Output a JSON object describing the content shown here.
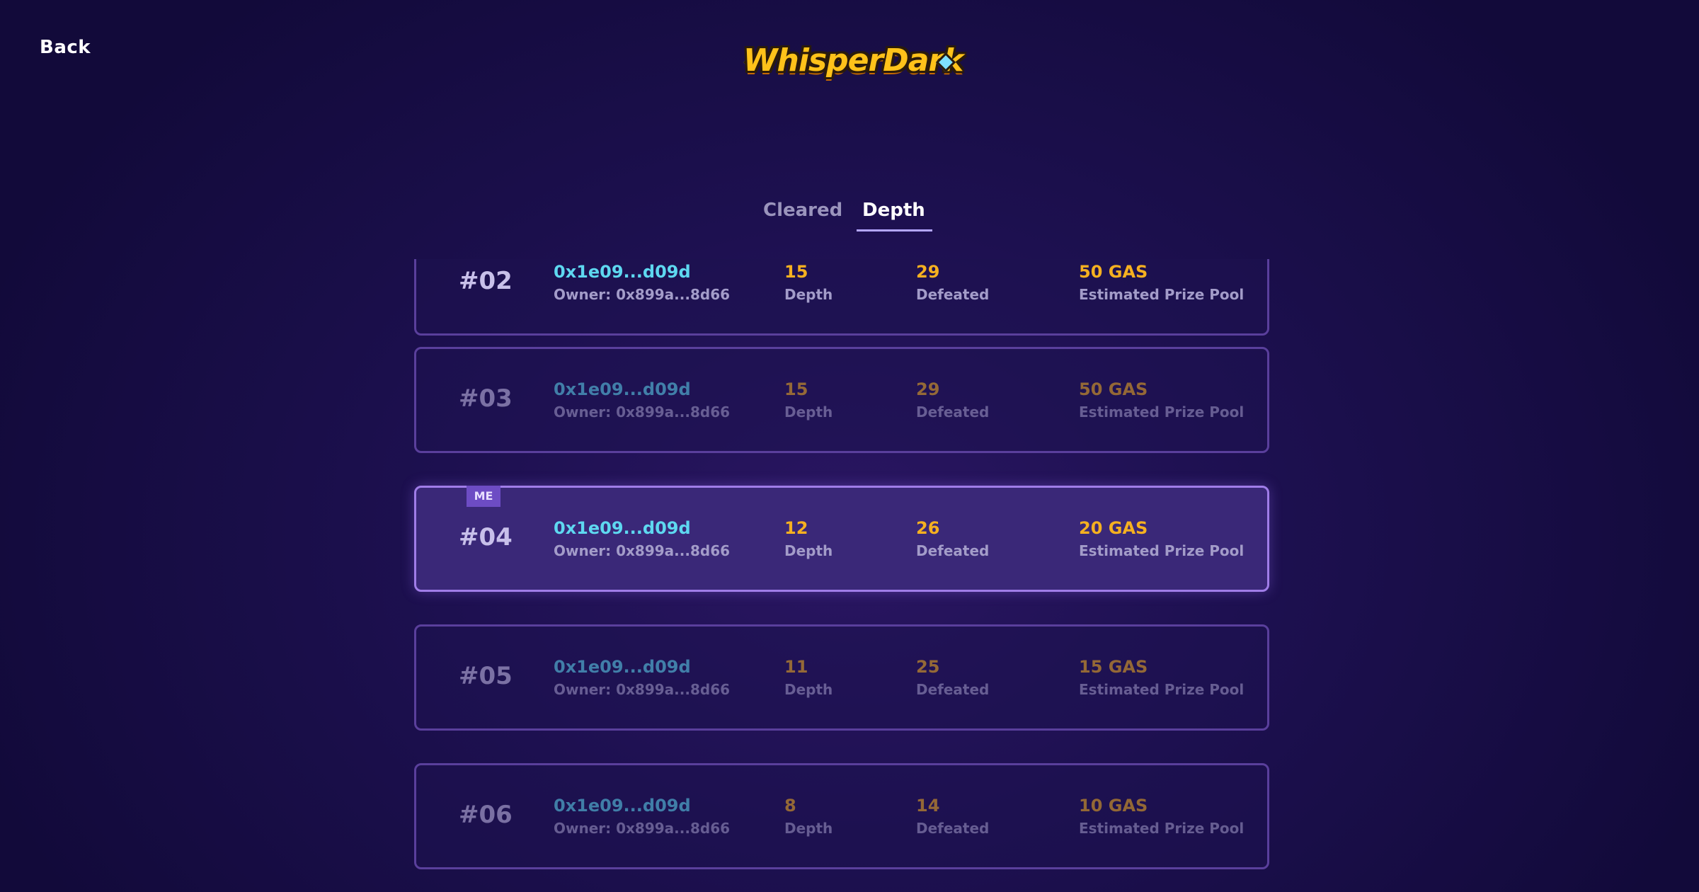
{
  "header": {
    "back_label": "Back",
    "logo_text": "WhisperDark"
  },
  "tabs": [
    {
      "label": "Cleared",
      "active": false
    },
    {
      "label": "Depth",
      "active": true
    }
  ],
  "labels": {
    "depth": "Depth",
    "defeated": "Defeated",
    "prize": "Estimated Prize Pool",
    "me_badge": "ME"
  },
  "entries": [
    {
      "rank": "#02",
      "address": "0x1e09...d09d",
      "owner": "Owner: 0x899a...8d66",
      "depth": "15",
      "defeated": "29",
      "prize": "50 GAS",
      "is_me": false
    },
    {
      "rank": "#03",
      "address": "0x1e09...d09d",
      "owner": "Owner: 0x899a...8d66",
      "depth": "15",
      "defeated": "29",
      "prize": "50 GAS",
      "is_me": false
    },
    {
      "rank": "#04",
      "address": "0x1e09...d09d",
      "owner": "Owner: 0x899a...8d66",
      "depth": "12",
      "defeated": "26",
      "prize": "20 GAS",
      "is_me": true
    },
    {
      "rank": "#05",
      "address": "0x1e09...d09d",
      "owner": "Owner: 0x899a...8d66",
      "depth": "11",
      "defeated": "25",
      "prize": "15 GAS",
      "is_me": false
    },
    {
      "rank": "#06",
      "address": "0x1e09...d09d",
      "owner": "Owner: 0x899a...8d66",
      "depth": "8",
      "defeated": "14",
      "prize": "10 GAS",
      "is_me": false
    }
  ],
  "colors": {
    "background": "#1d1050",
    "accent_gold": "#f5b020",
    "accent_cyan": "#5ed8f0",
    "card_border": "#5a3f9c",
    "me_highlight": "#3a2878"
  }
}
